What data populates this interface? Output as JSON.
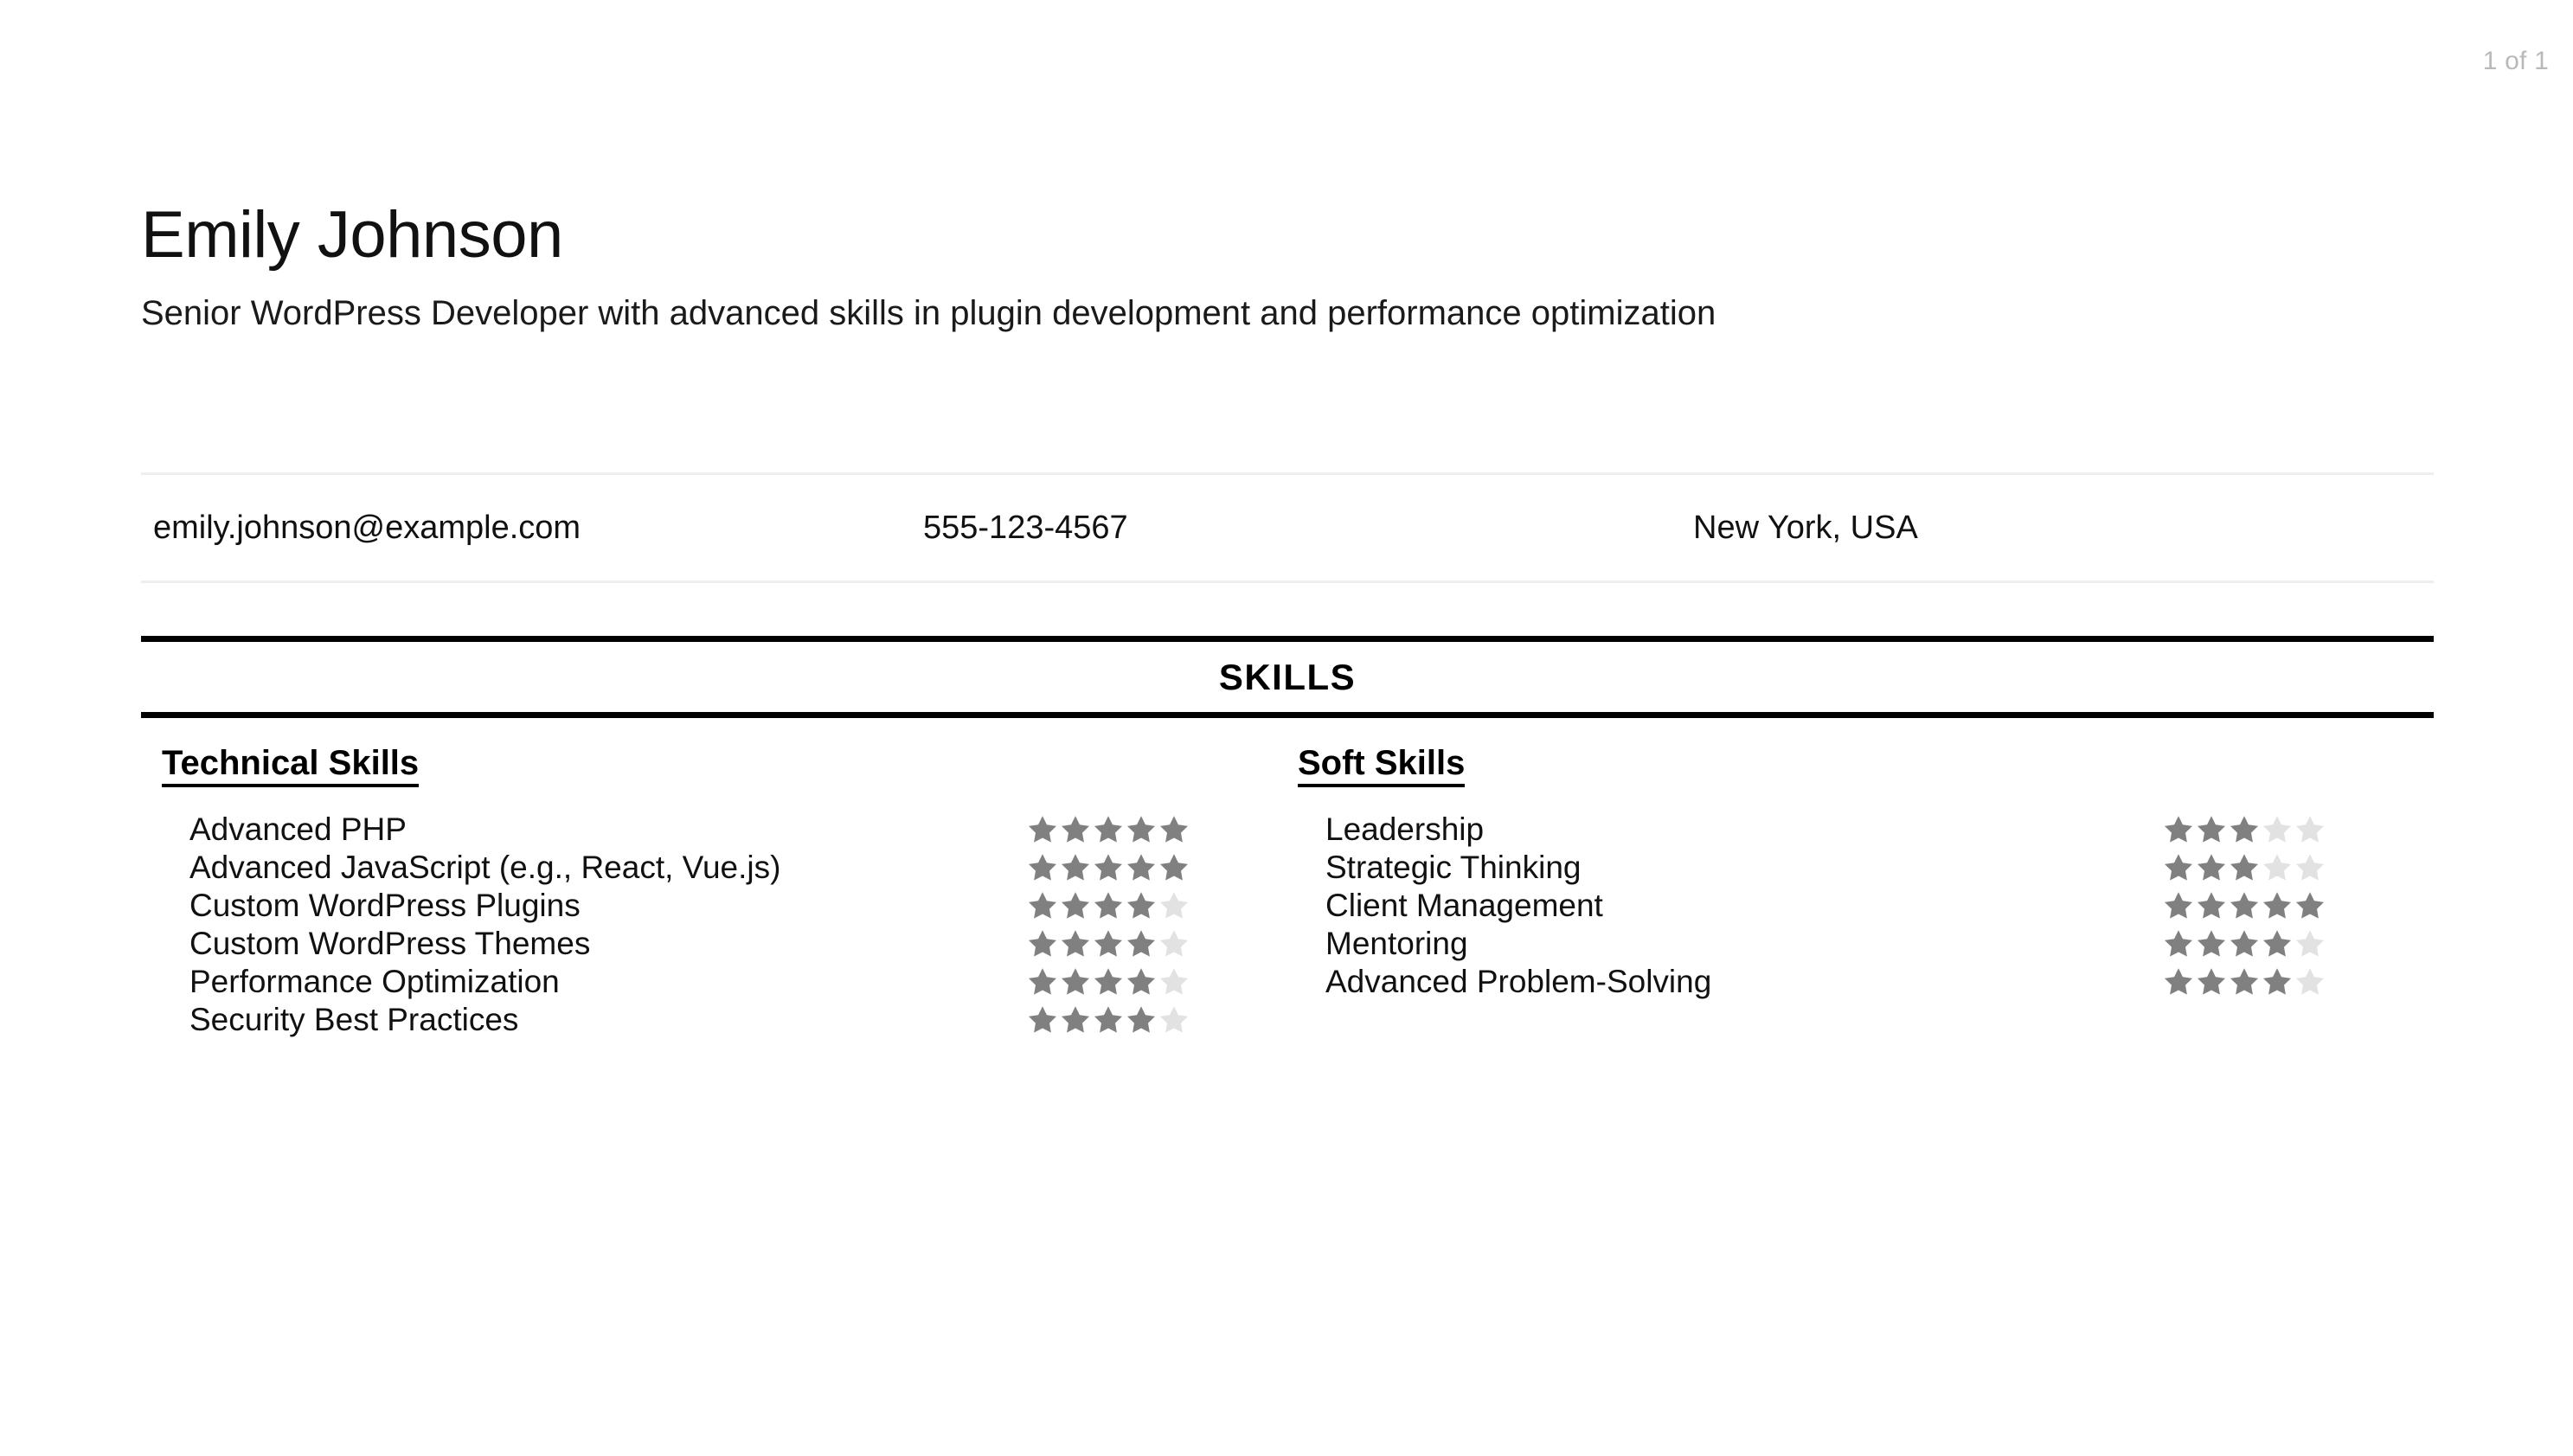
{
  "page": {
    "indicator": "1 of 1"
  },
  "header": {
    "name": "Emily Johnson",
    "headline": "Senior WordPress Developer with advanced skills in plugin development and performance optimization"
  },
  "contact": {
    "email": "emily.johnson@example.com",
    "phone": "555-123-4567",
    "location": "New York, USA"
  },
  "skills_section": {
    "title": "SKILLS",
    "max_rating": 5,
    "columns": [
      {
        "title": "Technical Skills",
        "items": [
          {
            "label": "Advanced PHP",
            "rating": 5
          },
          {
            "label": "Advanced JavaScript (e.g., React, Vue.js)",
            "rating": 5
          },
          {
            "label": "Custom WordPress Plugins",
            "rating": 4
          },
          {
            "label": "Custom WordPress Themes",
            "rating": 4
          },
          {
            "label": "Performance Optimization",
            "rating": 4
          },
          {
            "label": "Security Best Practices",
            "rating": 4
          }
        ]
      },
      {
        "title": "Soft Skills",
        "items": [
          {
            "label": "Leadership",
            "rating": 3
          },
          {
            "label": "Strategic Thinking",
            "rating": 3
          },
          {
            "label": "Client Management",
            "rating": 5
          },
          {
            "label": "Mentoring",
            "rating": 4
          },
          {
            "label": "Advanced Problem-Solving",
            "rating": 4
          }
        ]
      }
    ]
  },
  "colors": {
    "star_filled": "#808080",
    "star_empty": "#e2e2e2",
    "rule_light": "#eeeeee",
    "rule_dark": "#000000",
    "page_indicator": "#b9b9b9"
  }
}
